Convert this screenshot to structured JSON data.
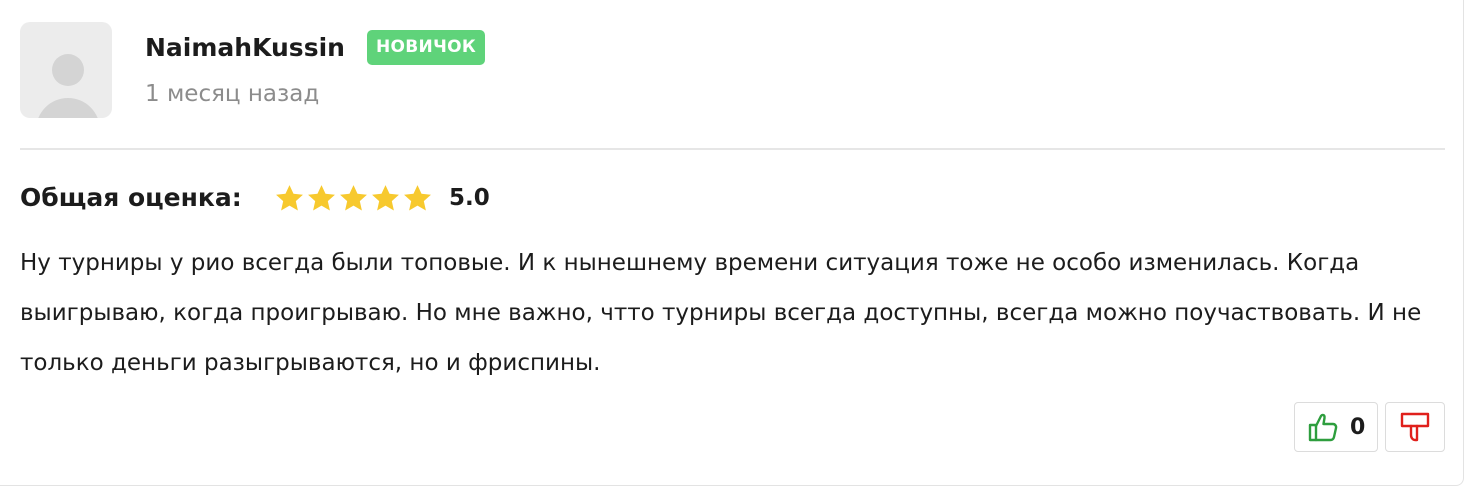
{
  "review": {
    "username": "NaimahKussin",
    "badge": "НОВИЧОК",
    "time_ago": "1 месяц назад",
    "rating_label": "Общая оценка:",
    "rating_value": "5.0",
    "stars_filled": 5,
    "stars_total": 5,
    "text": "Ну турниры у рио всегда были топовые. И к нынешнему времени ситуация тоже не особо изменилась. Когда выигрываю, когда проигрываю. Но мне важно, чтто турниры всегда доступны, всегда можно поучаствовать. И не только деньги разыгрываются, но и фриспины.",
    "likes": "0"
  },
  "colors": {
    "badge_bg": "#5fd37a",
    "star": "#f7c92e",
    "like_icon": "#2e9e3e",
    "dislike_icon": "#e0201c",
    "muted_text": "#8c8c8c"
  },
  "icons": {
    "avatar": "user-placeholder-icon",
    "star": "star-icon",
    "like": "thumbs-up-icon",
    "dislike": "thumbs-down-icon"
  }
}
